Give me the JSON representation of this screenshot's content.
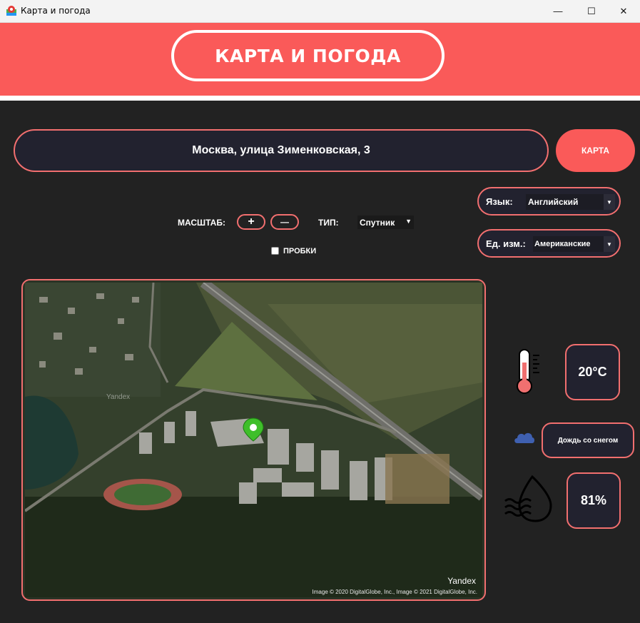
{
  "window": {
    "title": "Карта и погода",
    "controls": {
      "minimize": "—",
      "maximize": "☐",
      "close": "✕"
    }
  },
  "header": {
    "title": "КАРТА И ПОГОДА"
  },
  "search": {
    "value": "Москва, улица Зименковская, 3",
    "button_label": "КАРТА"
  },
  "controls": {
    "scale_label": "МАСШТАБ:",
    "zoom_in": "+",
    "zoom_out": "—",
    "type_label": "ТИП:",
    "type_value": "Спутник",
    "traffic_label": "ПРОБКИ",
    "traffic_checked": false
  },
  "settings": {
    "language_label": "Язык:",
    "language_value": "Английский",
    "units_label": "Ед. изм.:",
    "units_value": "Американские"
  },
  "map": {
    "brand": "Yandex",
    "watermark": "Yandex",
    "copyright": "Image © 2020 DigitalGlobe, Inc., Image © 2021 DigitalGlobe, Inc.",
    "marker_color": "#3fbf2a"
  },
  "weather": {
    "temperature": "20°C",
    "condition": "Дождь со снегом",
    "humidity": "81%"
  },
  "colors": {
    "accent": "#fa5a59",
    "border": "#f26f6f",
    "background": "#222222"
  }
}
